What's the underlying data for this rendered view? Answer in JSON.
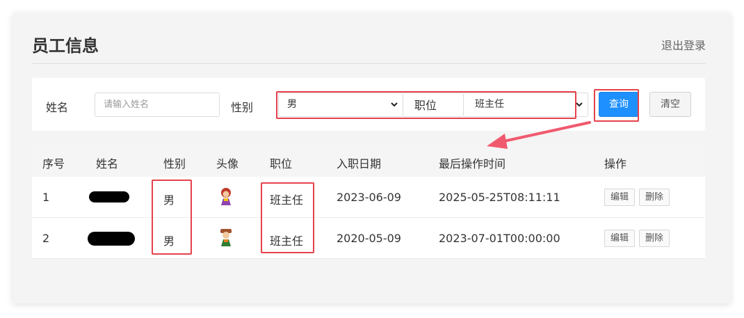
{
  "header": {
    "title": "员工信息",
    "logout_label": "退出登录"
  },
  "search": {
    "name_label": "姓名",
    "name_placeholder": "请输入姓名",
    "name_value": "",
    "gender_label": "性别",
    "gender_selected": "男",
    "position_label": "职位",
    "position_selected": "班主任",
    "query_label": "查询",
    "clear_label": "清空"
  },
  "table": {
    "headers": [
      "序号",
      "姓名",
      "性别",
      "头像",
      "职位",
      "入职日期",
      "最后操作时间",
      "操作"
    ],
    "rows": [
      {
        "index": "1",
        "gender": "男",
        "position": "班主任",
        "entry_date": "2023-06-09",
        "last_update": "2025-05-25T08:11:11",
        "edit_label": "编辑",
        "delete_label": "删除"
      },
      {
        "index": "2",
        "gender": "男",
        "position": "班主任",
        "entry_date": "2020-05-09",
        "last_update": "2023-07-01T00:00:00",
        "edit_label": "编辑",
        "delete_label": "删除"
      }
    ]
  },
  "colors": {
    "primary": "#1e90ff",
    "annotation": "#e5414b",
    "arrow": "#f05a6e"
  },
  "icons": {
    "select_caret": "chevron-down-icon",
    "avatar": "avatar-icon"
  }
}
